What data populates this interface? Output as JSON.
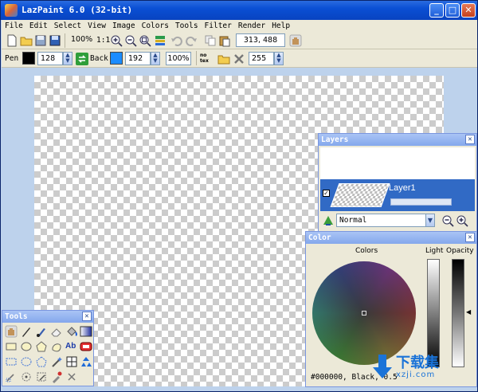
{
  "window": {
    "title": "LazPaint 6.0 (32-bit)"
  },
  "menu": [
    "File",
    "Edit",
    "Select",
    "View",
    "Image",
    "Colors",
    "Tools",
    "Filter",
    "Render",
    "Help"
  ],
  "toolbar": {
    "zoom": "100%",
    "zoom_actual": "1:1",
    "coords": "313, 488"
  },
  "pen": {
    "label": "Pen",
    "color": "#000000",
    "alpha": "128"
  },
  "back": {
    "label": "Back",
    "color": "#1a8cff",
    "alpha": "192"
  },
  "opacity": "100%",
  "tex_label": "no tex",
  "tex_alpha": "255",
  "layers": {
    "title": "Layers",
    "layer_name": "Layer1",
    "blend_mode": "Normal"
  },
  "color_panel": {
    "title": "Color",
    "colors_label": "Colors",
    "light_label": "Light",
    "opacity_label": "Opacity",
    "value_text": "#000000, Black, 0.5"
  },
  "tools_panel": {
    "title": "Tools",
    "text_tool": "Ab"
  },
  "watermark": {
    "text": "下载集",
    "sub": "xzji.com"
  }
}
